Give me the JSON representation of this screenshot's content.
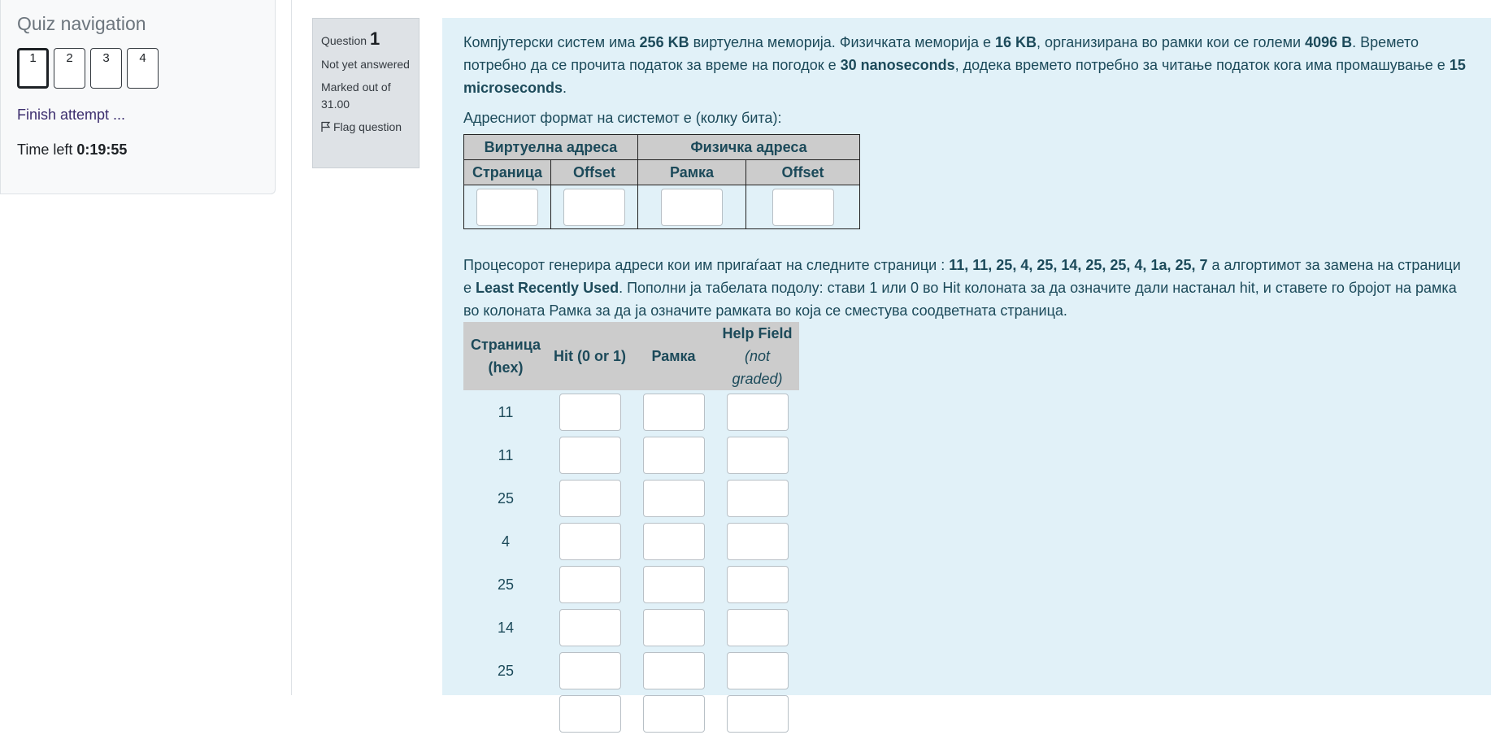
{
  "nav": {
    "title": "Quiz navigation",
    "questions": [
      "1",
      "2",
      "3",
      "4"
    ],
    "finish_label": "Finish attempt ...",
    "time_left_label": "Time left",
    "time_left_value": "0:19:55"
  },
  "qinfo": {
    "question_label": "Question",
    "question_number": "1",
    "status": "Not yet answered",
    "marked_label": "Marked out of",
    "marked_value": "31.00",
    "flag_label": "Flag question"
  },
  "body": {
    "p1": {
      "t1": "Компјутерски систем има ",
      "b1": "256 KB",
      "t2": " виртуелна меморија. Физичката меморија е ",
      "b2": "16 KB",
      "t3": ", организирана во рамки кои се големи ",
      "b3": "4096 B",
      "t4": ". Времето потребно да се прочита податок за време на погодок е ",
      "b4": "30 nanoseconds",
      "t5": ", додека времето потребно за читање податок кога има промашување е ",
      "b5": "15 microseconds",
      "t6": "."
    },
    "p2": "Адресниот формат на системот е (колку бита):",
    "addr_table": {
      "virtual_header": "Виртуелна адреса",
      "physical_header": "Физичка адреса",
      "sub_page": "Страница",
      "sub_offset1": "Offset",
      "sub_frame": "Рамка",
      "sub_offset2": "Offset"
    },
    "p3": {
      "t1": "Процесорот генерира адреси кои им пригаѓаат на следните страници : ",
      "b1": "11, 11, 25, 4, 25, 14, 25, 25, 4, 1a, 25, 7",
      "t2": " а алгортимот за замена на страници е  ",
      "b2": "Least Recently Used",
      "t3": ". Пополни ја табелата подолу: стави 1 или 0 во Hit колоната за да означите дали настанал hit, и ставете го бројот на рамка во колоната  Рамка за да ја означите рамката во која се сместува соодветната страница."
    },
    "pages_table": {
      "h_page_1": "Страница",
      "h_page_2": "(hex)",
      "h_hit": "Hit (0 or 1)",
      "h_frame": "Рамка",
      "h_help_1": "Help Field",
      "h_help_2": "(not graded)",
      "rows": [
        "11",
        "11",
        "25",
        "4",
        "25",
        "14",
        "25"
      ]
    }
  }
}
